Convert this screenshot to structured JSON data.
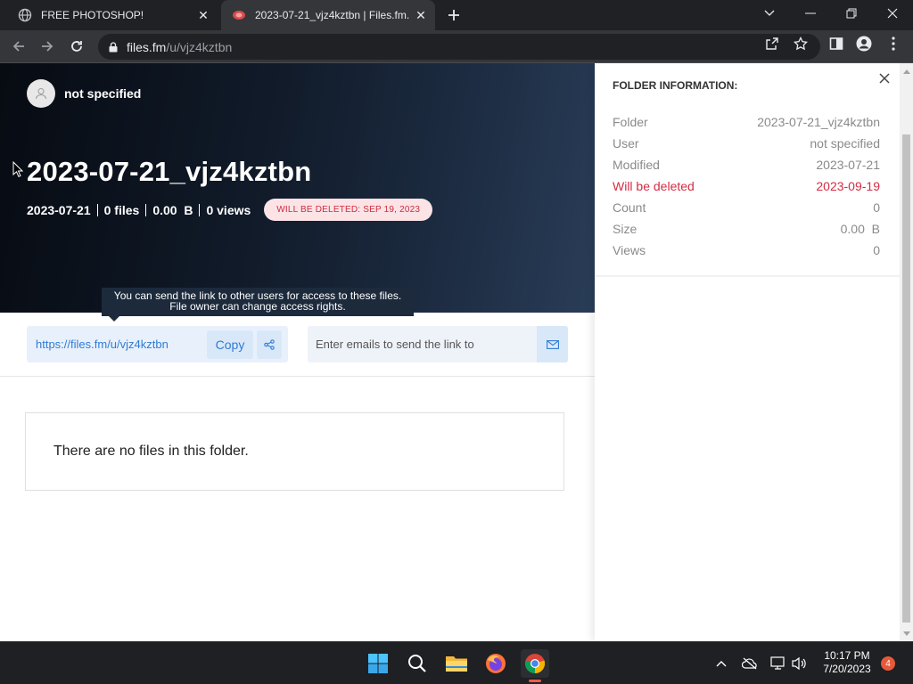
{
  "browser": {
    "tabs": [
      {
        "title": "FREE PHOTOSHOP!",
        "favicon": "globe-icon",
        "active": false
      },
      {
        "title": "2023-07-21_vjz4kztbn | Files.fm.",
        "favicon": "filesfm-icon",
        "active": true
      }
    ],
    "address": {
      "domain": "files.fm",
      "path": "/u/vjz4kztbn"
    }
  },
  "page": {
    "owner_name": "not specified",
    "folder_title": "2023-07-21_vjz4kztbn",
    "stats": {
      "date": "2023-07-21",
      "files": "0 files",
      "size": "0.00  B",
      "views": "0 views"
    },
    "delete_badge": "WILL BE DELETED: SEP 19, 2023",
    "tooltip_line1": "You can send the link to other users for access to these files.",
    "tooltip_line2": "File owner can change access rights.",
    "share_link": "https://files.fm/u/vjz4kztbn",
    "copy_label": "Copy",
    "email_placeholder": "Enter emails to send the link to",
    "empty_message": "There are no files in this folder."
  },
  "info_panel": {
    "heading": "FOLDER INFORMATION:",
    "rows": [
      {
        "label": "Folder",
        "value": "2023-07-21_vjz4kztbn"
      },
      {
        "label": "User",
        "value": "not specified"
      },
      {
        "label": "Modified",
        "value": "2023-07-21"
      },
      {
        "label": "Will be deleted",
        "value": "2023-09-19"
      },
      {
        "label": "Count",
        "value": "0"
      },
      {
        "label": "Size",
        "value": "0.00  B"
      },
      {
        "label": "Views",
        "value": "0"
      }
    ]
  },
  "taskbar": {
    "time": "10:17 PM",
    "date": "7/20/2023",
    "notification_count": "4"
  },
  "colors": {
    "accent_blue": "#2f7bd6",
    "delete_red": "#d52b42",
    "hero_dark": "#070b12"
  }
}
